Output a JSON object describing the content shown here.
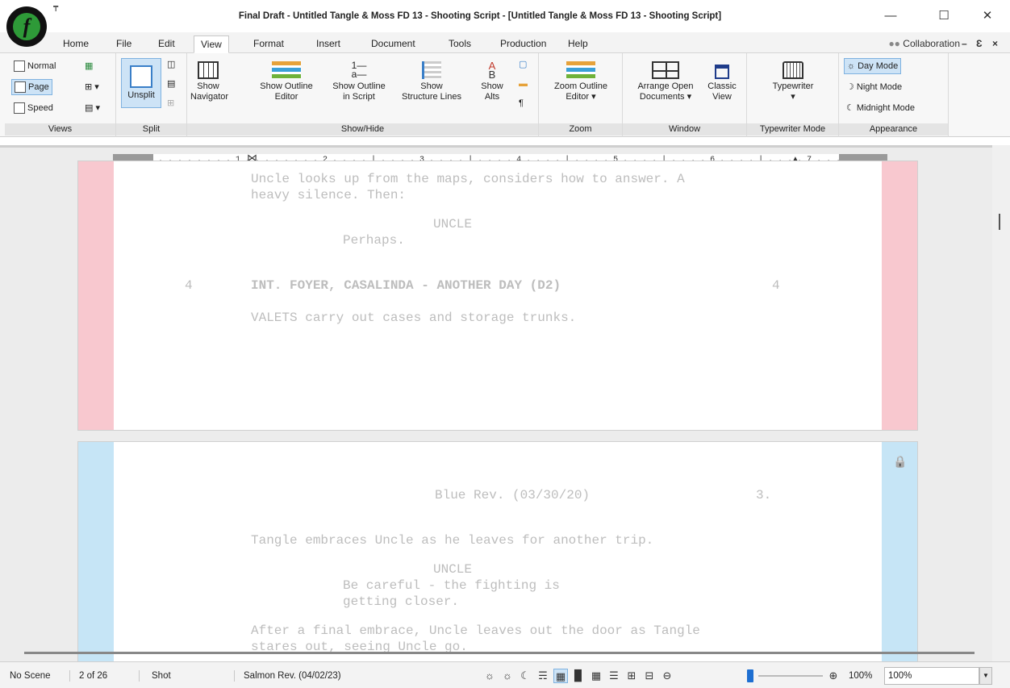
{
  "title": "Final Draft - Untitled Tangle & Moss FD 13 - Shooting Script - [Untitled Tangle & Moss FD 13 - Shooting Script]",
  "qat_glyph": "₸",
  "window_controls": {
    "minimize": "—",
    "maximize": "☐",
    "close": "✕"
  },
  "tabs": [
    "Home",
    "File",
    "Edit",
    "View",
    "Format",
    "Insert",
    "Document",
    "Tools",
    "Production",
    "Help"
  ],
  "collaboration": "Collaboration",
  "mdi_controls": {
    "minimize": "–",
    "restore": "Ɛ",
    "close": "×"
  },
  "ribbon": {
    "views": {
      "label": "Views",
      "normal": "Normal",
      "page": "Page",
      "speed": "Speed"
    },
    "split": {
      "label": "Split",
      "unsplit": "Unsplit"
    },
    "showhide": {
      "label": "Show/Hide",
      "navigator": [
        "Show",
        "Navigator"
      ],
      "outline_editor": [
        "Show Outline",
        "Editor"
      ],
      "outline_script": [
        "Show Outline",
        "in Script"
      ],
      "structure": [
        "Show",
        "Structure Lines"
      ],
      "alts": [
        "Show",
        "Alts"
      ]
    },
    "zoom": {
      "label": "Zoom",
      "outline_editor": [
        "Zoom Outline",
        "Editor ▾"
      ]
    },
    "window": {
      "label": "Window",
      "arrange": [
        "Arrange Open",
        "Documents ▾"
      ],
      "classic": [
        "Classic",
        "View"
      ]
    },
    "typewriter": {
      "label": "Typewriter Mode",
      "typewriter": [
        "Typewriter",
        "▾"
      ]
    },
    "appearance": {
      "label": "Appearance",
      "day": "Day Mode",
      "night": "Night Mode",
      "midnight": "Midnight Mode"
    }
  },
  "ruler": {
    "marks": ". . . .   . . . . 1 . . . . . . . . 2 . . . . | . . . . 3 . . . . | . . . . 4 . . . . | . . . . 5 . . . . | . . . . 6 . . . . | . . . . 7 . . . . . . . . ."
  },
  "page1": {
    "lines": [
      "Uncle looks up from the maps, considers how to answer. A",
      "heavy silence. Then:",
      "UNCLE",
      "Perhaps.",
      "4",
      "INT. FOYER, CASALINDA - ANOTHER DAY (D2)",
      "4",
      "VALETS carry out cases and storage trunks."
    ]
  },
  "page2": {
    "header_rev": "Blue Rev. (03/30/20)",
    "page_num": "3.",
    "lines": [
      "Tangle embraces Uncle as he leaves for another trip.",
      "UNCLE",
      "Be careful - the fighting is",
      "getting closer.",
      "After a final embrace, Uncle leaves out the door as Tangle",
      "stares out, seeing Uncle go."
    ],
    "lock_glyph": "🔒"
  },
  "status": {
    "scene": "No Scene",
    "page": "2  of  26",
    "element": "Shot",
    "revision": "Salmon Rev. (04/02/23)",
    "zoom_pct": "100%",
    "zoom_select": "100%"
  }
}
